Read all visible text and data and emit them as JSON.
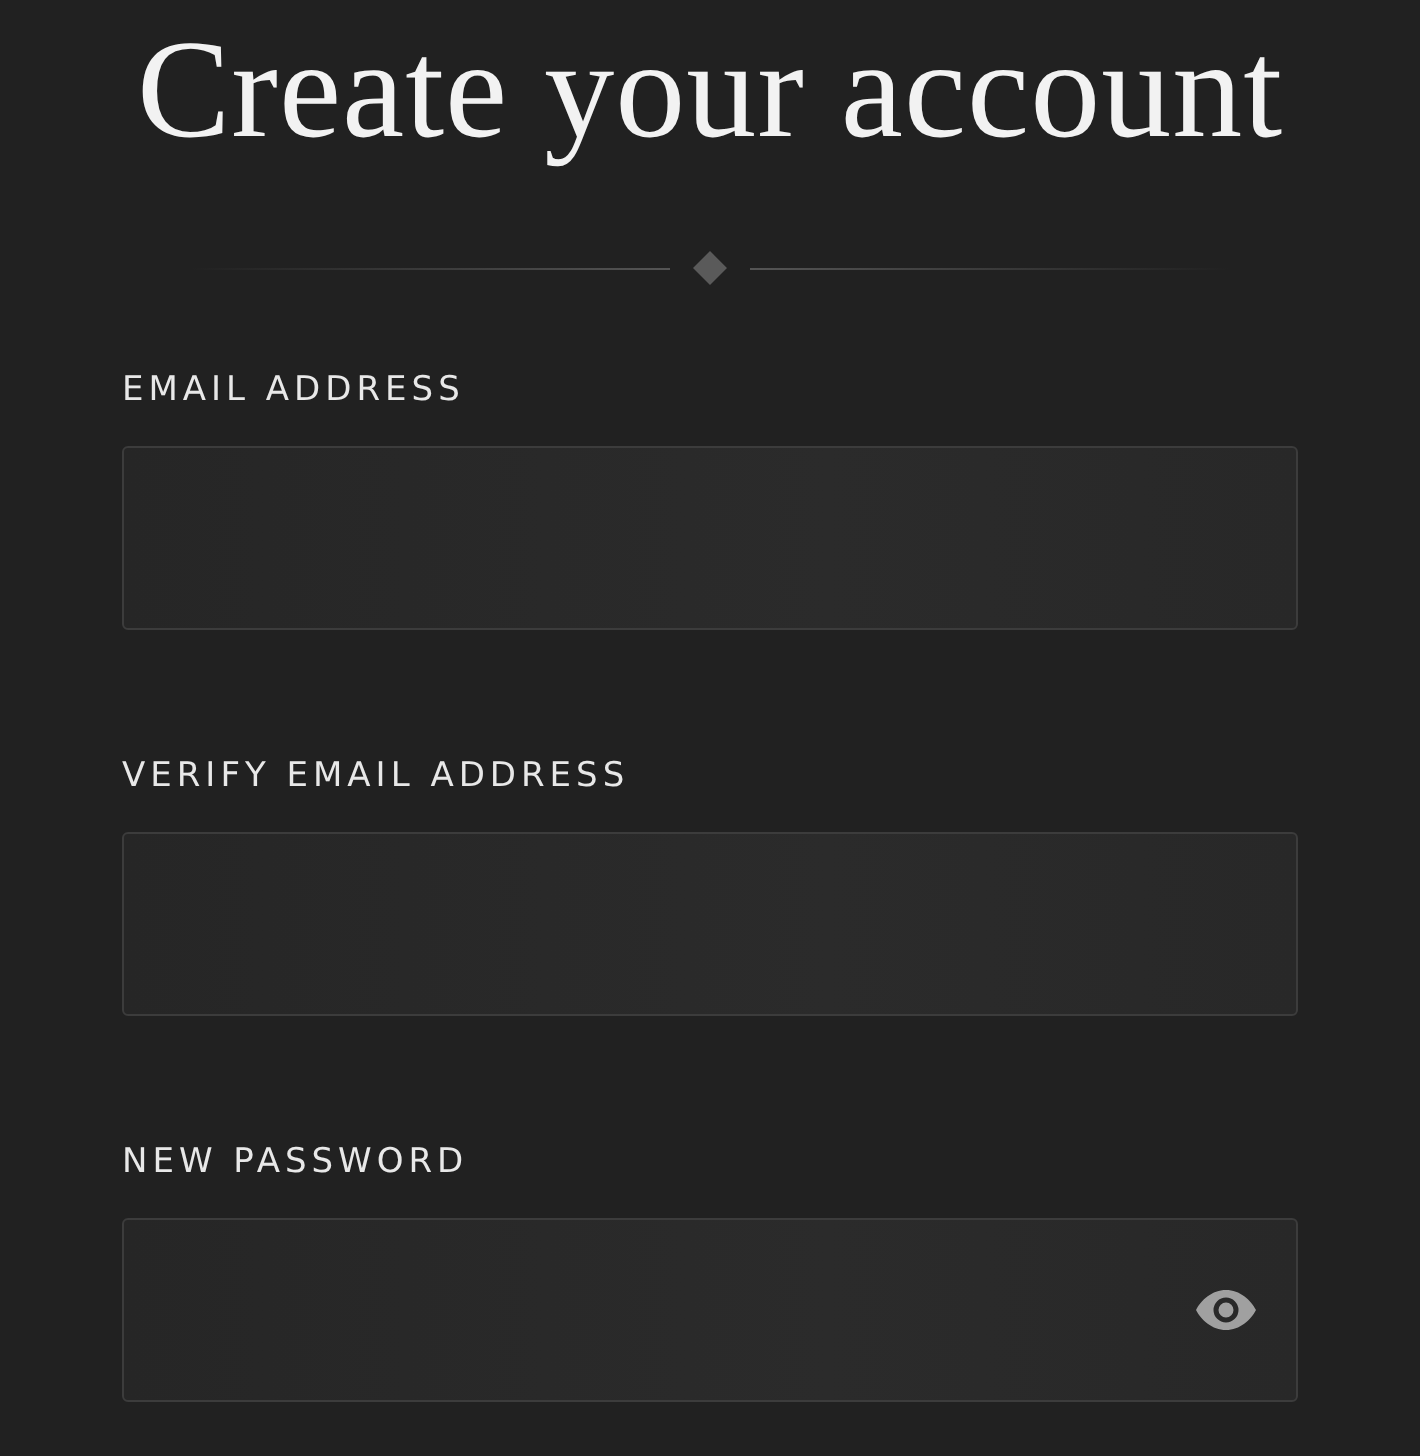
{
  "title": "Create your account",
  "fields": [
    {
      "label": "EMAIL ADDRESS",
      "kind": "text"
    },
    {
      "label": "VERIFY EMAIL ADDRESS",
      "kind": "text"
    },
    {
      "label": "NEW PASSWORD",
      "kind": "password"
    }
  ]
}
